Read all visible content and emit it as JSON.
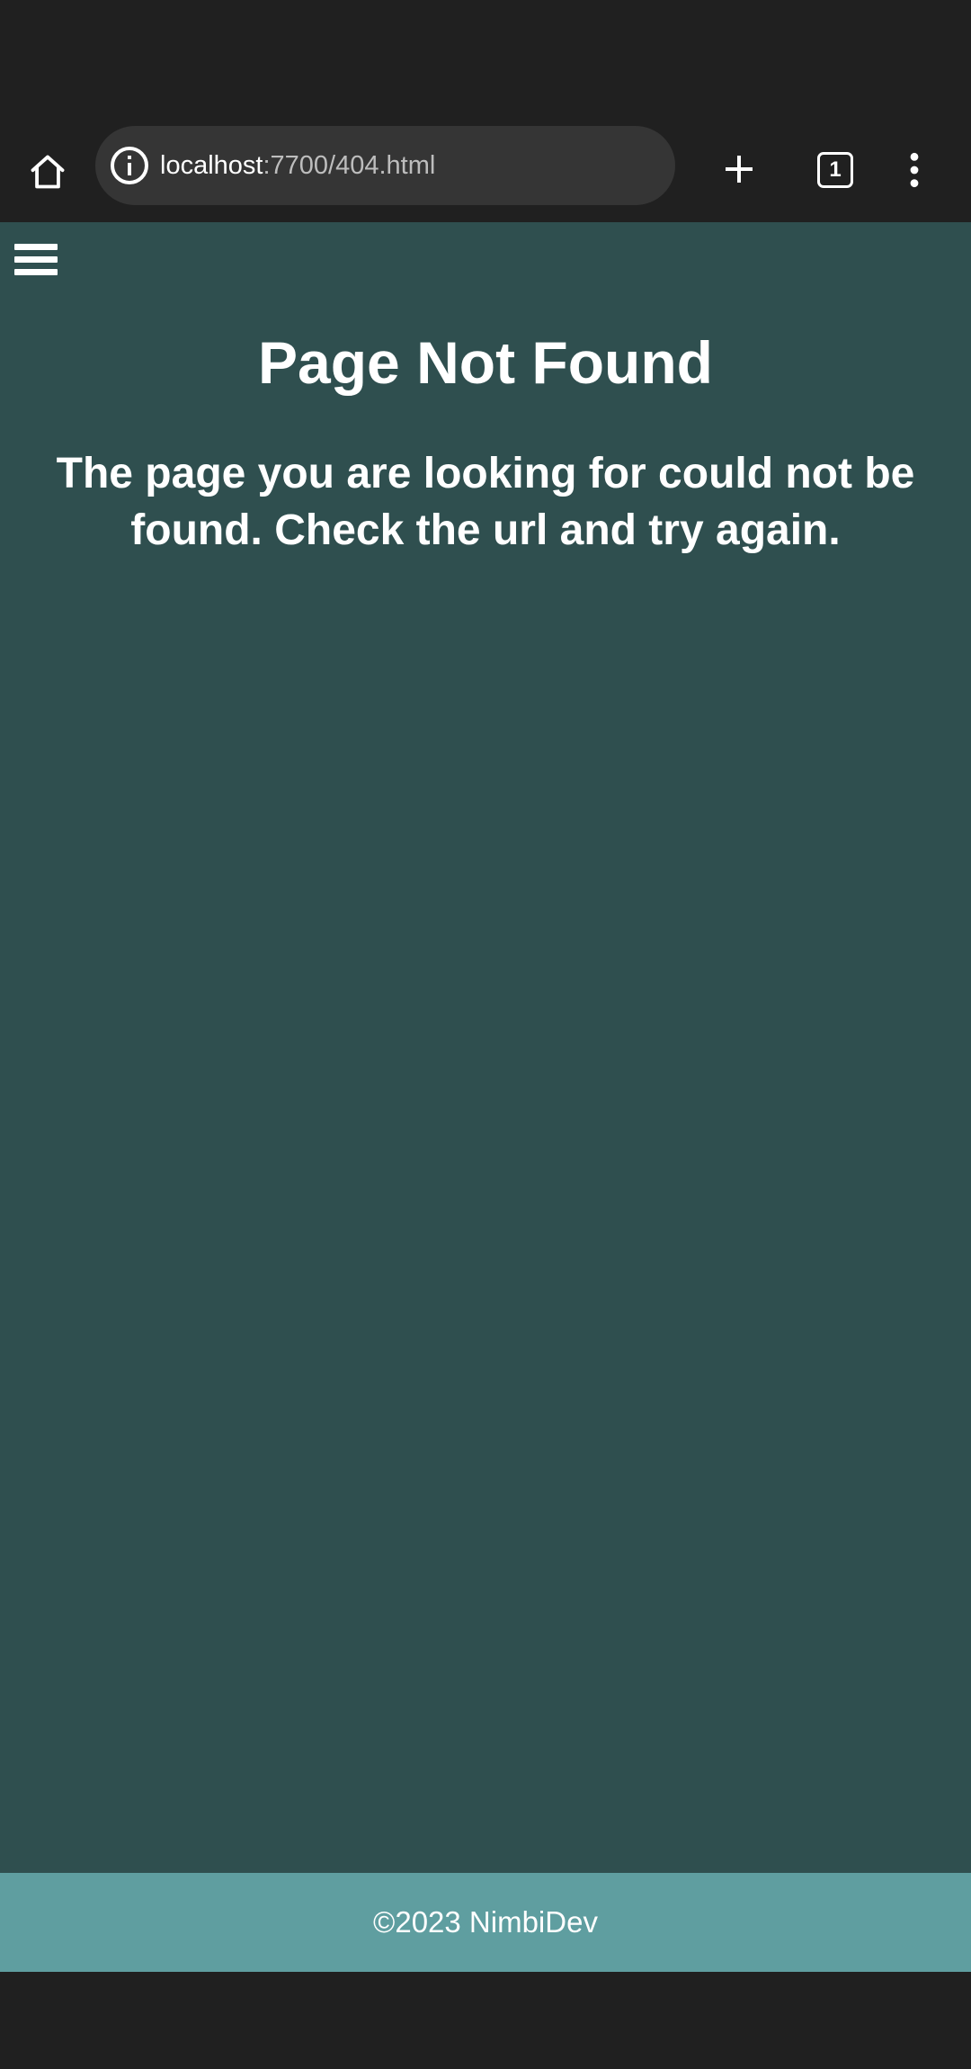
{
  "browser": {
    "url_host": "localhost",
    "url_path": ":7700/404.html",
    "tab_count": "1",
    "icons": {
      "home": "home-icon",
      "info": "info-icon",
      "new_tab": "plus-icon",
      "tabs": "tab-switcher-icon",
      "menu": "kebab-menu-icon"
    }
  },
  "page": {
    "menu_icon": "hamburger-icon",
    "title": "Page Not Found",
    "message": "The page you are looking for could not be found. Check the url and try again.",
    "footer": "©2023 NimbiDev",
    "colors": {
      "background": "#2f4f4f",
      "footer": "#5f9ea0",
      "browser_chrome": "#202020"
    }
  }
}
